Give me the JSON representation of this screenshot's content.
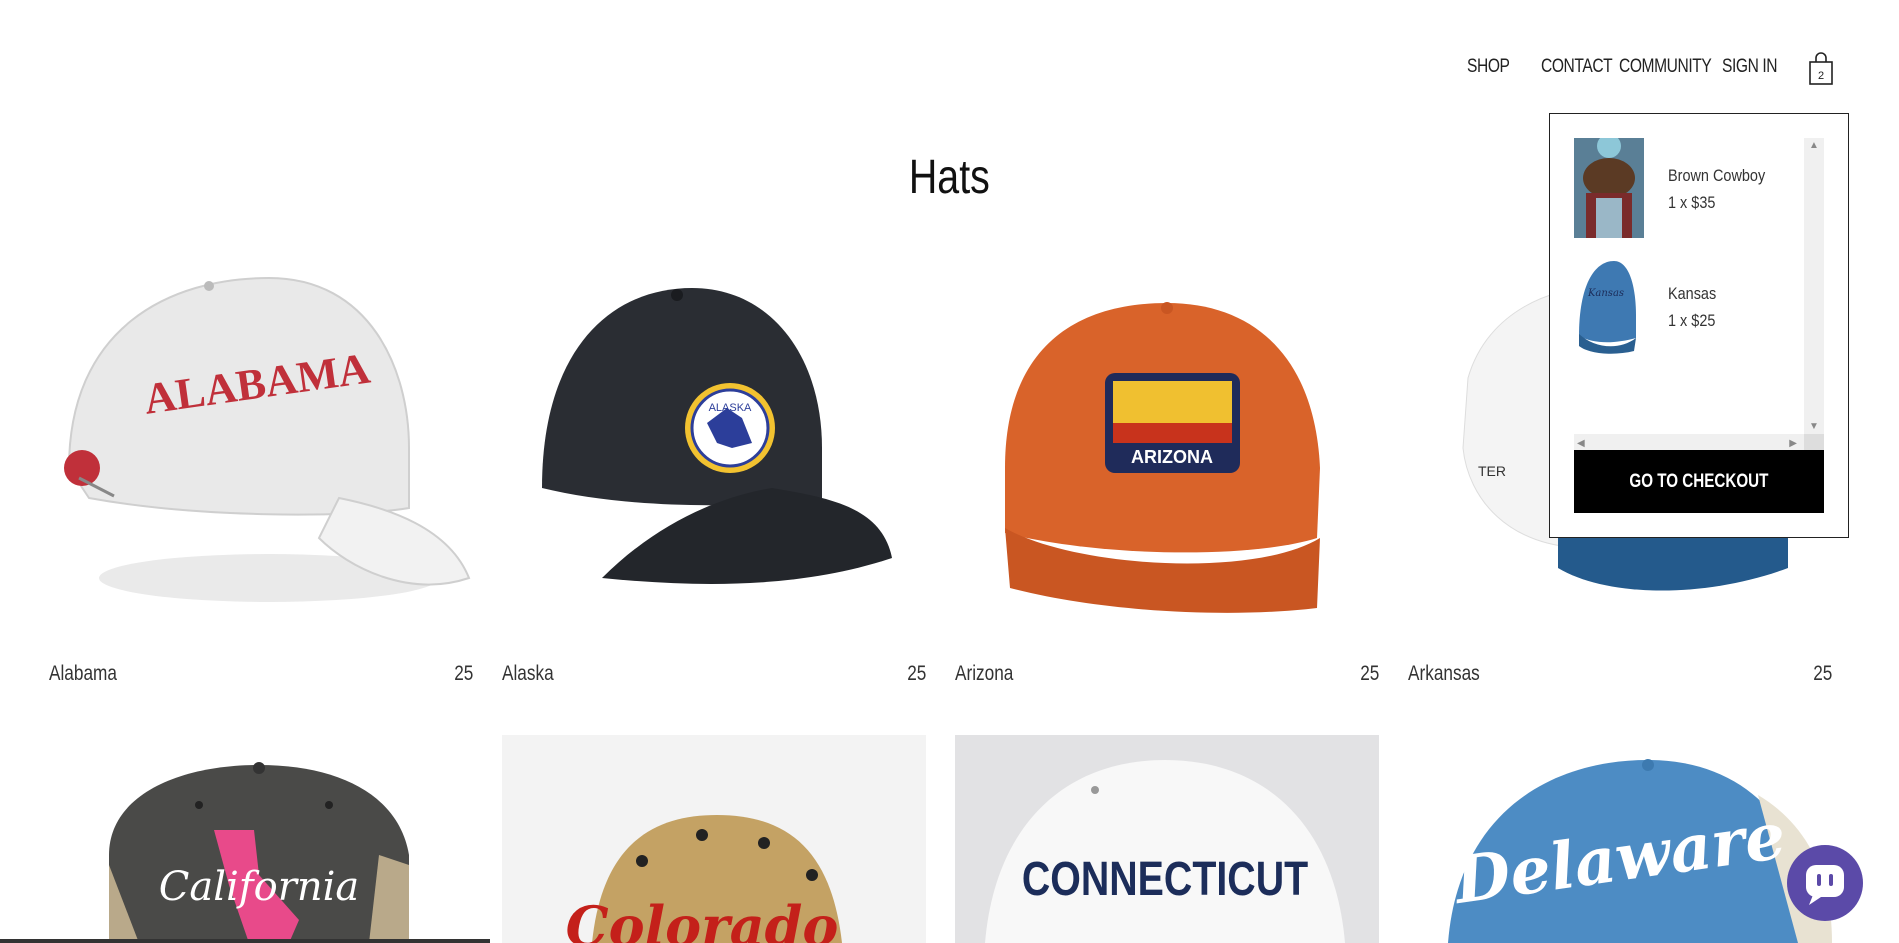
{
  "nav": {
    "shop": "SHOP",
    "contact": "CONTACT",
    "community": "COMMUNITY",
    "sign_in": "SIGN IN",
    "cart_count": "2"
  },
  "page": {
    "title": "Hats"
  },
  "products": [
    {
      "name": "Alabama",
      "price": "25"
    },
    {
      "name": "Alaska",
      "price": "25"
    },
    {
      "name": "Arizona",
      "price": "25"
    },
    {
      "name": "Arkansas",
      "price": "25"
    }
  ],
  "second_row": [
    "California",
    "Colorado",
    "Connecticut",
    "Delaware"
  ],
  "hat_text": {
    "alabama": "ALABAMA",
    "alaska": "ALASKA",
    "arizona": "ARIZONA",
    "california": "California",
    "colorado": "Colorado",
    "connecticut": "CONNECTICUT",
    "delaware": "Delaware"
  },
  "cart": {
    "items": [
      {
        "name": "Brown Cowboy",
        "qty": "1 x $35"
      },
      {
        "name": "Kansas",
        "qty": "1 x $25"
      }
    ],
    "checkout_label": "GO TO CHECKOUT"
  },
  "colors": {
    "accent": "#000000",
    "chat": "#5b4aa8"
  },
  "icons": {
    "cart": "shopping-bag-icon",
    "chat": "chat-icon"
  }
}
